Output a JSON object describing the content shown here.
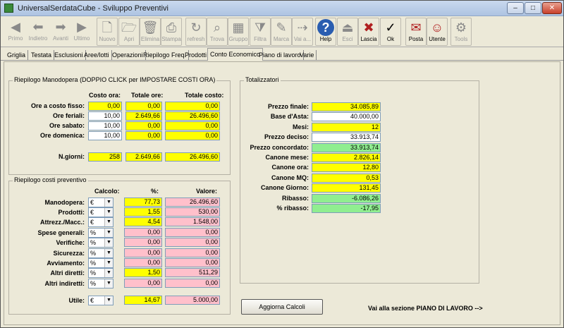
{
  "window": {
    "title": "UniversalSerdataCube - Sviluppo Preventivi",
    "min": "–",
    "max": "□",
    "close": "✕"
  },
  "toolbar": [
    {
      "label": "Primo",
      "icon": "◀"
    },
    {
      "label": "Indietro",
      "icon": "⬅"
    },
    {
      "label": "Avanti",
      "icon": "➡"
    },
    {
      "label": "Ultimo",
      "icon": "▶"
    },
    {
      "label": "Nuovo",
      "icon": "🗋"
    },
    {
      "label": "Apri",
      "icon": "🗁"
    },
    {
      "label": "Elimina",
      "icon": "🗑"
    },
    {
      "label": "Stampa",
      "icon": "⎙"
    },
    {
      "label": "refresh",
      "icon": "↻"
    },
    {
      "label": "Trova",
      "icon": "⌕"
    },
    {
      "label": "Gruppo",
      "icon": "▦"
    },
    {
      "label": "Filtra",
      "icon": "⧩"
    },
    {
      "label": "Marca",
      "icon": "✎"
    },
    {
      "label": "Vai a...",
      "icon": "⇢"
    },
    {
      "label": "Help",
      "icon": "?"
    },
    {
      "label": "Esci",
      "icon": "⏏"
    },
    {
      "label": "Lascia",
      "icon": "✖"
    },
    {
      "label": "Ok",
      "icon": "✓"
    },
    {
      "label": "Posta",
      "icon": "✉"
    },
    {
      "label": "Utente",
      "icon": "☺"
    },
    {
      "label": "Tools",
      "icon": "⚙"
    }
  ],
  "tabs": [
    "Griglia",
    "Testata",
    "Esclusioni",
    "Aree/lotti",
    "Operazioni",
    "Riepilogo Freq.",
    "Prodotti",
    "Conto Economico",
    "Piano di lavoro",
    "Varie"
  ],
  "manodopera": {
    "legend": "Riepilogo Manodopera (DOPPIO CLICK per IMPOSTARE COSTI ORA)",
    "headers": [
      "Costo ora:",
      "Totale ore:",
      "Totale costo:"
    ],
    "rows": [
      {
        "label": "Ore a costo fisso:",
        "costo": "0,00",
        "ore": "0,00",
        "totale": "0,00"
      },
      {
        "label": "Ore feriali:",
        "costo": "10,00",
        "ore": "2.649,66",
        "totale": "26.496,60"
      },
      {
        "label": "Ore sabato:",
        "costo": "10,00",
        "ore": "0,00",
        "totale": "0,00"
      },
      {
        "label": "Ore domenica:",
        "costo": "10,00",
        "ore": "0,00",
        "totale": "0,00"
      }
    ],
    "giorni": {
      "label": "N.giorni:",
      "giorni": "258",
      "ore": "2.649,66",
      "totale": "26.496,60"
    }
  },
  "costi": {
    "legend": "Riepilogo costi preventivo",
    "headers": [
      "Calcolo:",
      "%:",
      "Valore:"
    ],
    "rows": [
      {
        "label": "Manodopera:",
        "calc": "€",
        "pct": "77,73",
        "val": "26.496,60"
      },
      {
        "label": "Prodotti:",
        "calc": "€",
        "pct": "1,55",
        "val": "530,00"
      },
      {
        "label": "Attrezz./Macc.:",
        "calc": "€",
        "pct": "4,54",
        "val": "1.548,00"
      },
      {
        "label": "Spese generali:",
        "calc": "%",
        "pct": "0,00",
        "val": "0,00"
      },
      {
        "label": "Verifiche:",
        "calc": "%",
        "pct": "0,00",
        "val": "0,00"
      },
      {
        "label": "Sicurezza:",
        "calc": "%",
        "pct": "0,00",
        "val": "0,00"
      },
      {
        "label": "Avviamento:",
        "calc": "%",
        "pct": "0,00",
        "val": "0,00"
      },
      {
        "label": "Altri diretti:",
        "calc": "%",
        "pct": "1,50",
        "val": "511,29"
      },
      {
        "label": "Altri indiretti:",
        "calc": "%",
        "pct": "0,00",
        "val": "0,00"
      }
    ],
    "utile": {
      "label": "Utile:",
      "calc": "€",
      "pct": "14,67",
      "val": "5.000,00"
    }
  },
  "totalizzatori": {
    "legend": "Totalizzatori",
    "rows": [
      {
        "label": "Prezzo finale:",
        "value": "34.085,89",
        "color": "#ffff00"
      },
      {
        "label": "Base d'Asta:",
        "value": "40.000,00",
        "color": "#ffffff"
      },
      {
        "label": "Mesi:",
        "value": "12",
        "color": "#ffff00"
      },
      {
        "label": "Prezzo deciso:",
        "value": "33.913,74",
        "color": "#ffffff"
      },
      {
        "label": "Prezzo concordato:",
        "value": "33.913,74",
        "color": "#90ee90"
      },
      {
        "label": "Canone mese:",
        "value": "2.826,14",
        "color": "#ffff00"
      },
      {
        "label": "Canone ora:",
        "value": "12,80",
        "color": "#ffff00"
      },
      {
        "label": "Canone MQ:",
        "value": "0,53",
        "color": "#ffff00"
      },
      {
        "label": "Canone Giorno:",
        "value": "131,45",
        "color": "#ffff00"
      },
      {
        "label": "Ribasso:",
        "value": "-6.086,26",
        "color": "#90ee90"
      },
      {
        "label": "% ribasso:",
        "value": "-17,95",
        "color": "#90ee90"
      }
    ]
  },
  "actions": {
    "aggiorna": "Aggiorna Calcoli",
    "vai_piano": "Vai alla sezione PIANO DI LAVORO -->"
  }
}
